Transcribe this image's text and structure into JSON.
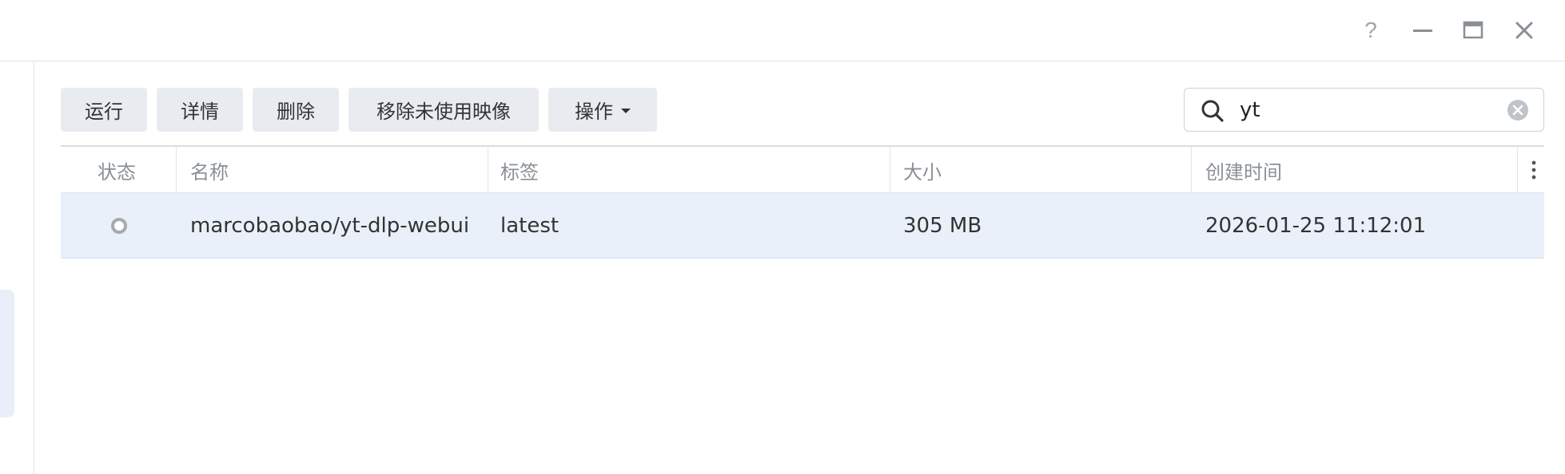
{
  "window_controls": {
    "help_icon": "question-icon",
    "minimize_icon": "minimize-icon",
    "maximize_icon": "maximize-icon",
    "close_icon": "close-icon"
  },
  "toolbar": {
    "run_label": "运行",
    "details_label": "详情",
    "delete_label": "删除",
    "remove_unused_label": "移除未使用映像",
    "actions_label": "操作"
  },
  "search": {
    "value": "yt",
    "icon": "search-icon",
    "clear_icon": "clear-icon"
  },
  "table": {
    "columns": [
      "状态",
      "名称",
      "标签",
      "大小",
      "创建时间"
    ],
    "rows": [
      {
        "status": "inactive",
        "name": "marcobaobao/yt-dlp-webui",
        "tag": "latest",
        "size": "305 MB",
        "created": "2026-01-25 11:12:01"
      }
    ]
  },
  "colors": {
    "button_bg": "#e8ecf0",
    "row_selected_bg": "#e9f0fa",
    "header_text": "#8a9096",
    "status_ring": "#a4aab0"
  }
}
